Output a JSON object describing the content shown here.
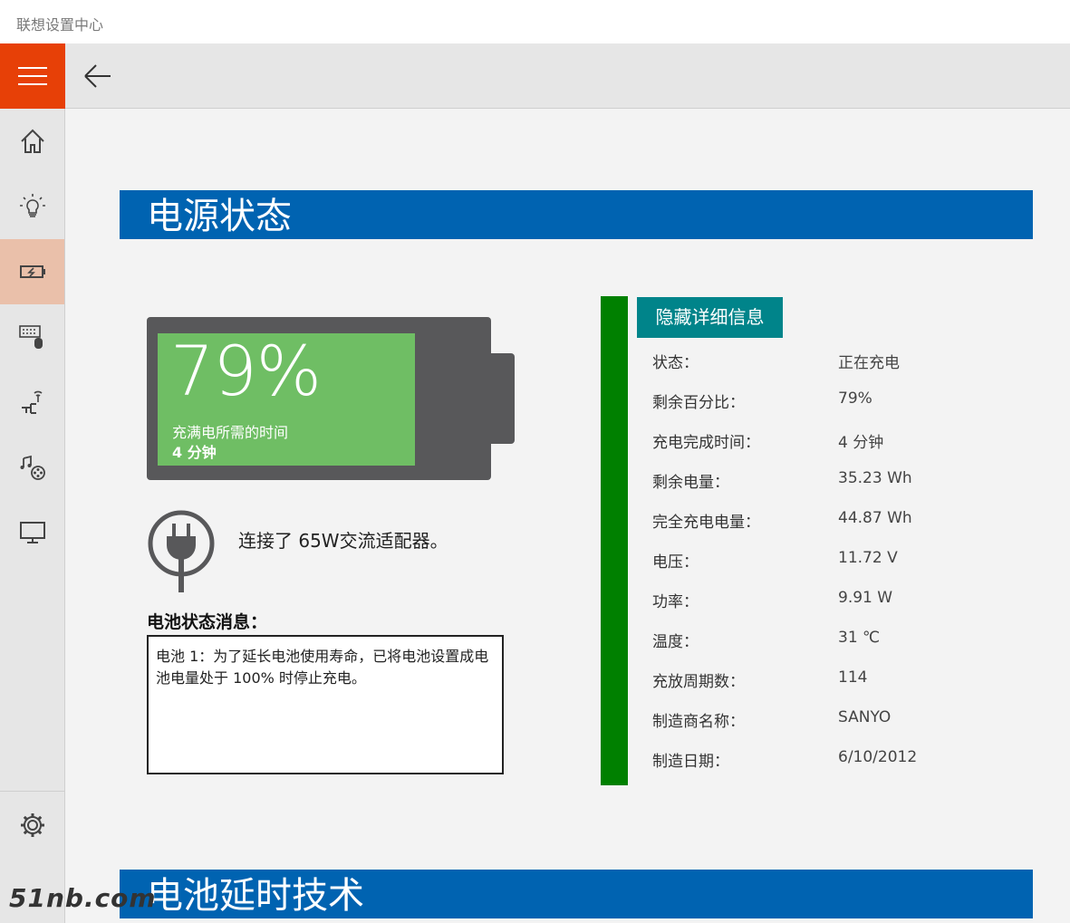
{
  "window": {
    "title": "联想设置中心"
  },
  "nav": {
    "menu_icon": "hamburger-menu-icon",
    "back_icon": "back-arrow-icon",
    "items": [
      {
        "icon": "home-icon",
        "active": false
      },
      {
        "icon": "lightbulb-icon",
        "active": false
      },
      {
        "icon": "battery-icon",
        "active": true
      },
      {
        "icon": "keyboard-mouse-icon",
        "active": false
      },
      {
        "icon": "network-icon",
        "active": false
      },
      {
        "icon": "audio-video-icon",
        "active": false
      },
      {
        "icon": "display-icon",
        "active": false
      }
    ],
    "settings_icon": "gear-icon"
  },
  "power": {
    "header": "电源状态",
    "battery": {
      "percent": "79%",
      "level": 0.79,
      "time_label": "充满电所需的时间",
      "time_value": "4 分钟"
    },
    "adapter_text": "连接了 65W交流适配器。",
    "message_title": "电池状态消息：",
    "message_body": "电池 1：为了延长电池使用寿命，已将电池设置成电池电量处于 100% 时停止充电。",
    "details_button": "隐藏详细信息",
    "details": [
      {
        "label": "状态：",
        "value": "正在充电"
      },
      {
        "label": "剩余百分比：",
        "value": "79%"
      },
      {
        "label": "充电完成时间：",
        "value": "4 分钟"
      },
      {
        "label": "剩余电量：",
        "value": "35.23 Wh"
      },
      {
        "label": "完全充电电量：",
        "value": "44.87 Wh"
      },
      {
        "label": "电压：",
        "value": "11.72 V"
      },
      {
        "label": "功率：",
        "value": "9.91 W"
      },
      {
        "label": "温度：",
        "value": "31 ℃"
      },
      {
        "label": "充放周期数：",
        "value": "114"
      },
      {
        "label": "制造商名称：",
        "value": "SANYO"
      },
      {
        "label": "制造日期：",
        "value": "6/10/2012"
      }
    ]
  },
  "extension": {
    "header": "电池延时技术"
  },
  "watermark": "51nb.com",
  "colors": {
    "accent": "#e74007",
    "header_blue": "#0063b1",
    "battery_green": "#6fbe64",
    "status_green": "#008000",
    "details_teal": "#00848a",
    "active_nav": "#eac0aa"
  }
}
